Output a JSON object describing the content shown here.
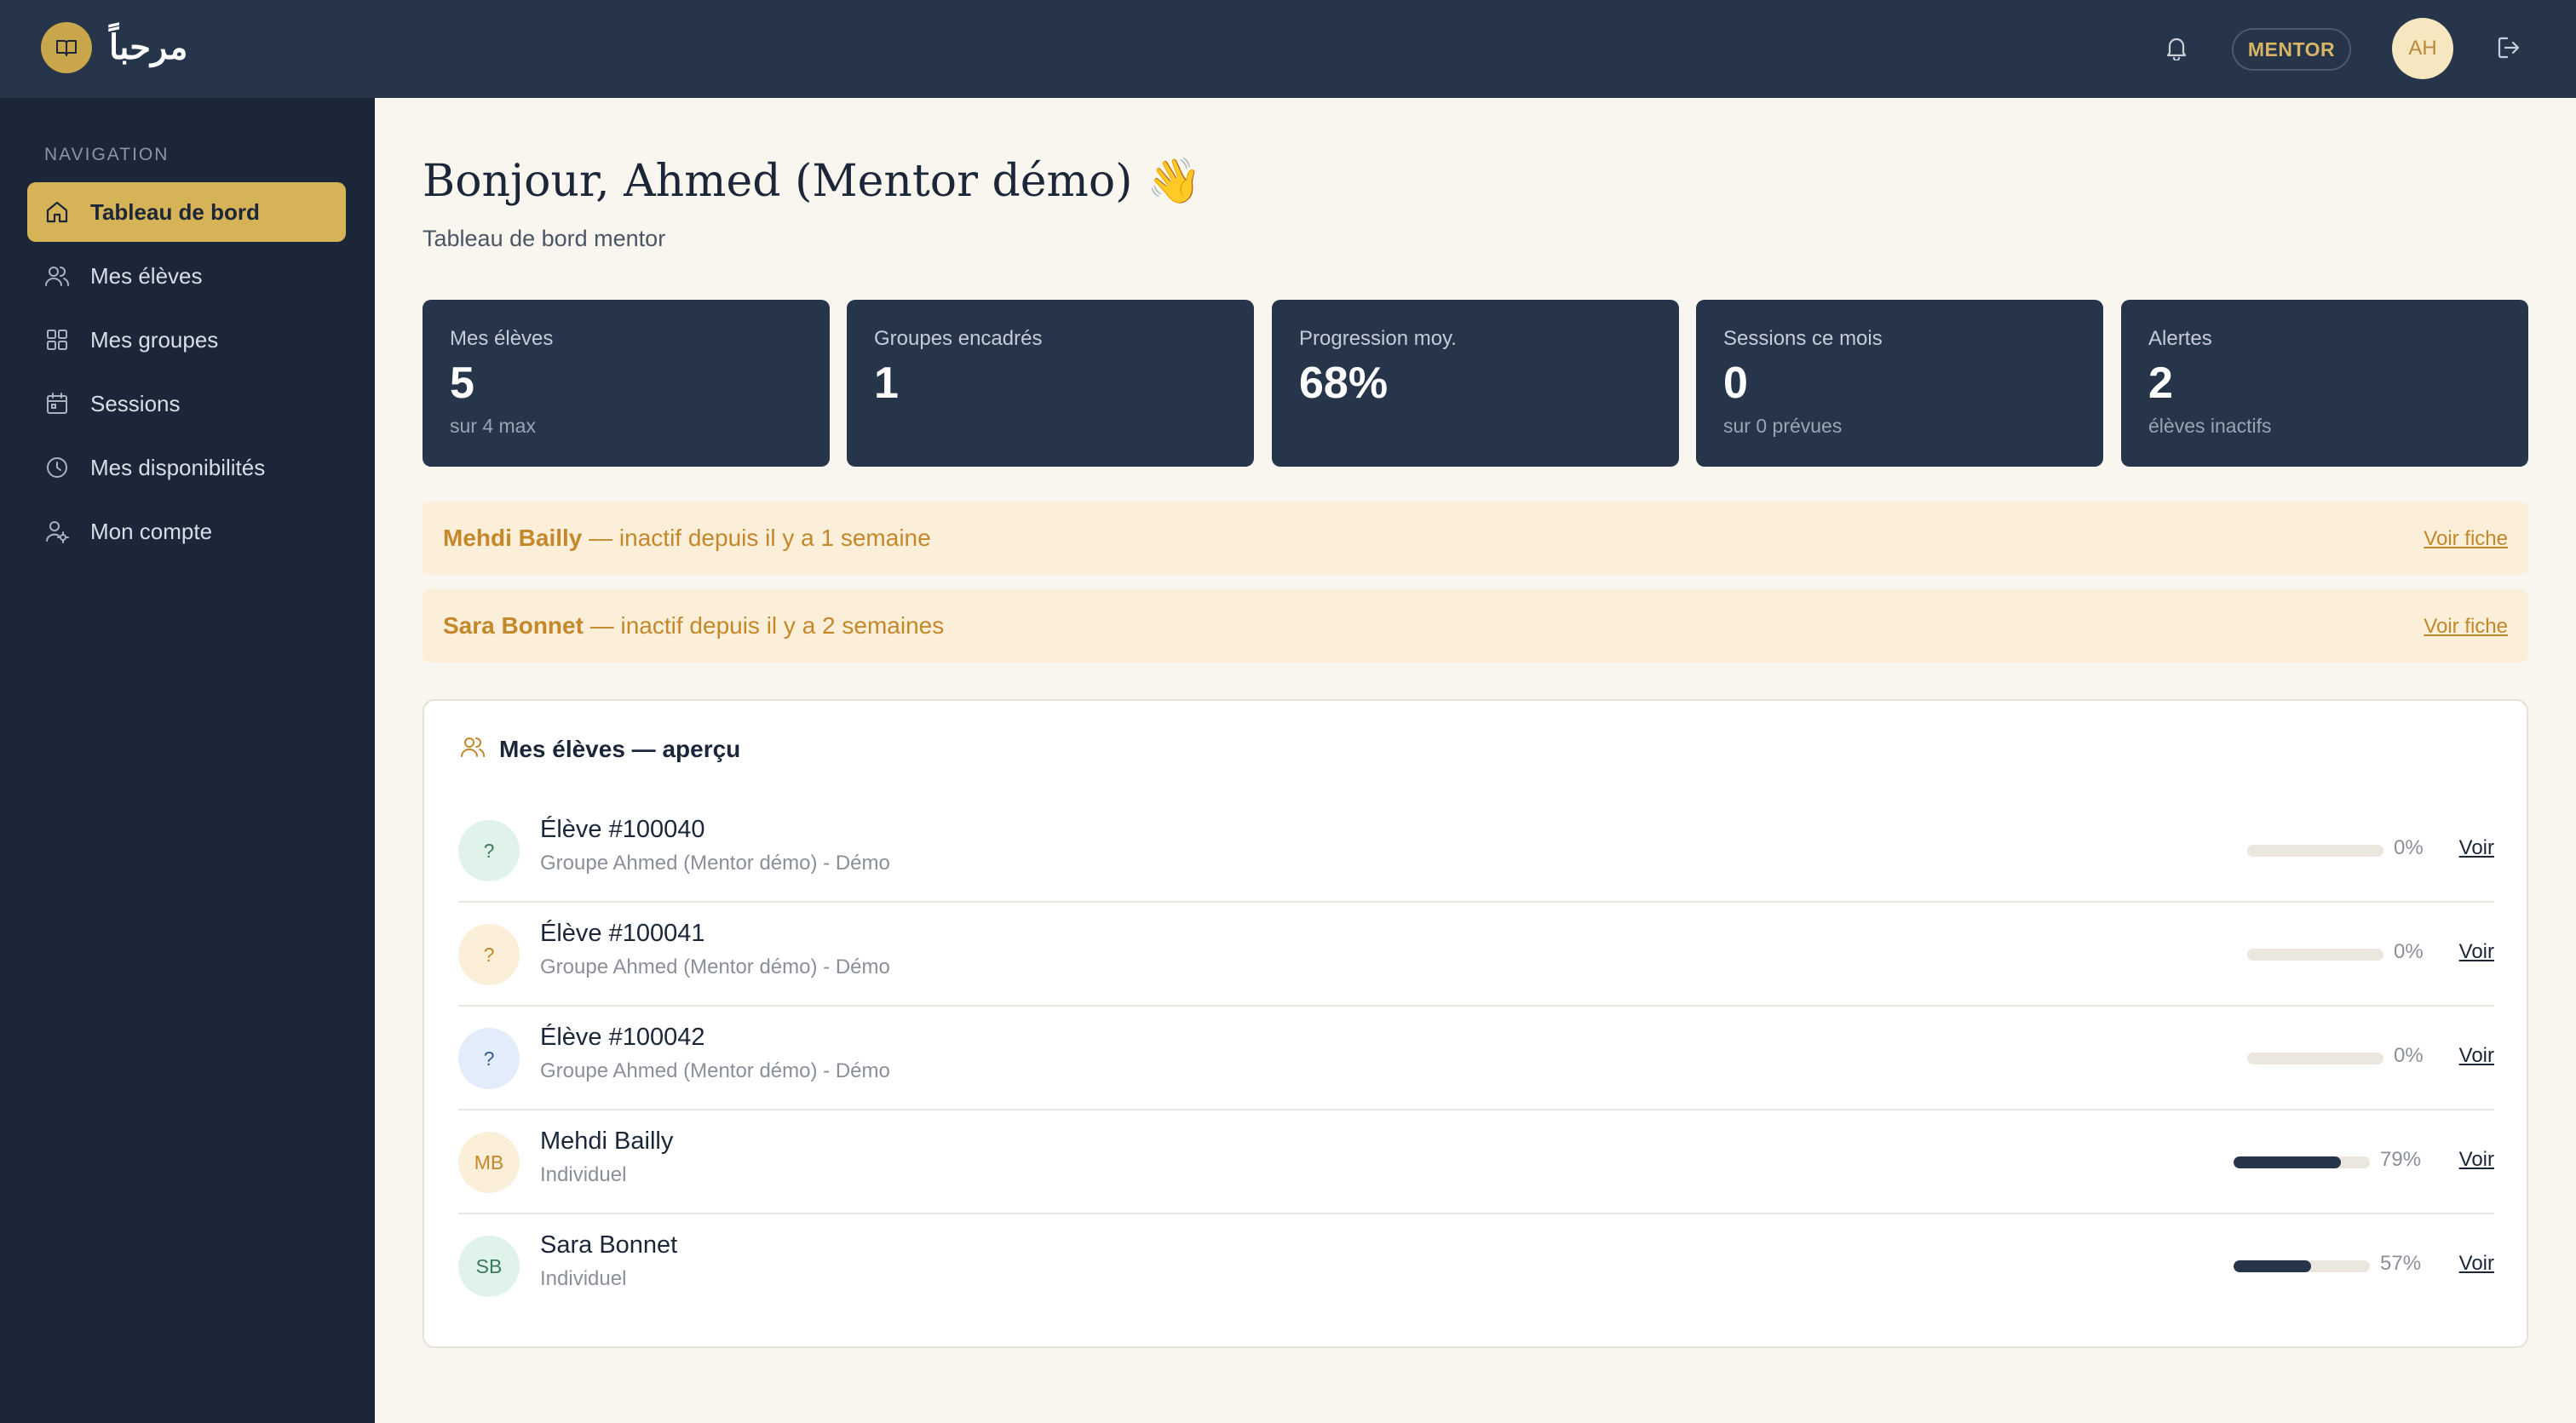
{
  "header": {
    "logo_text": "مرحباً",
    "role_badge": "MENTOR",
    "avatar_initials": "AH"
  },
  "sidebar": {
    "title": "NAVIGATION",
    "items": [
      {
        "label": "Tableau de bord",
        "icon": "home-icon",
        "active": true
      },
      {
        "label": "Mes élèves",
        "icon": "users-icon"
      },
      {
        "label": "Mes groupes",
        "icon": "grid-icon"
      },
      {
        "label": "Sessions",
        "icon": "calendar-icon"
      },
      {
        "label": "Mes disponibilités",
        "icon": "clock-icon"
      },
      {
        "label": "Mon compte",
        "icon": "user-settings-icon"
      }
    ]
  },
  "main": {
    "greeting": "Bonjour, Ahmed (Mentor démo) 👋",
    "subtitle": "Tableau de bord mentor",
    "stats": [
      {
        "label": "Mes élèves",
        "value": "5",
        "sub": "sur 4 max"
      },
      {
        "label": "Groupes encadrés",
        "value": "1",
        "sub": ""
      },
      {
        "label": "Progression moy.",
        "value": "68%",
        "sub": ""
      },
      {
        "label": "Sessions ce mois",
        "value": "0",
        "sub": "sur 0 prévues"
      },
      {
        "label": "Alertes",
        "value": "2",
        "sub": "élèves inactifs"
      }
    ],
    "alerts": [
      {
        "name": "Mehdi Bailly",
        "text": " — inactif depuis il y a 1 semaine",
        "link": "Voir fiche"
      },
      {
        "name": "Sara Bonnet",
        "text": " — inactif depuis il y a 2 semaines",
        "link": "Voir fiche"
      }
    ],
    "students_card": {
      "title": "Mes élèves — aperçu",
      "action_label": "Voir",
      "students": [
        {
          "initials": "?",
          "name": "Élève #100040",
          "group": "Groupe Ahmed (Mentor démo) - Démo",
          "progress": 0,
          "progress_label": "0%",
          "avatar_bg": "#dff3ea",
          "avatar_fg": "#3b7a5c"
        },
        {
          "initials": "?",
          "name": "Élève #100041",
          "group": "Groupe Ahmed (Mentor démo) - Démo",
          "progress": 0,
          "progress_label": "0%",
          "avatar_bg": "#fbefd9",
          "avatar_fg": "#c4872a"
        },
        {
          "initials": "?",
          "name": "Élève #100042",
          "group": "Groupe Ahmed (Mentor démo) - Démo",
          "progress": 0,
          "progress_label": "0%",
          "avatar_bg": "#e2ecfb",
          "avatar_fg": "#3a5a8c"
        },
        {
          "initials": "MB",
          "name": "Mehdi Bailly",
          "group": "Individuel",
          "progress": 79,
          "progress_label": "79%",
          "avatar_bg": "#fbefd9",
          "avatar_fg": "#c4872a"
        },
        {
          "initials": "SB",
          "name": "Sara Bonnet",
          "group": "Individuel",
          "progress": 57,
          "progress_label": "57%",
          "avatar_bg": "#dff3ea",
          "avatar_fg": "#3b7a5c"
        }
      ]
    }
  },
  "colors": {
    "topbar": "#26354a",
    "sidebar": "#1b2738",
    "accent_gold": "#d7b357",
    "alert_bg": "#fbefd9",
    "alert_text": "#c4872a",
    "page_bg": "#f8f6ef"
  }
}
